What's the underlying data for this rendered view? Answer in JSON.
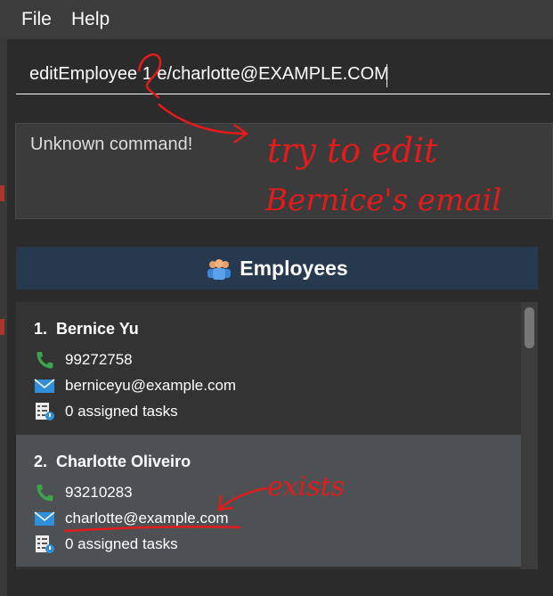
{
  "menu": {
    "file": "File",
    "help": "Help"
  },
  "command": {
    "value": "editEmployee 1 e/charlotte@EXAMPLE.COM"
  },
  "result": {
    "message": "Unknown command!"
  },
  "employees": {
    "title": "Employees",
    "items": [
      {
        "index": "1.",
        "name": "Bernice Yu",
        "phone": "99272758",
        "email": "berniceyu@example.com",
        "tasks": "0 assigned tasks"
      },
      {
        "index": "2.",
        "name": "Charlotte Oliveiro",
        "phone": "93210283",
        "email": "charlotte@example.com",
        "tasks": "0 assigned tasks"
      }
    ]
  },
  "annotations": {
    "note1": "try to edit",
    "note2": "Bernice's email",
    "note3": "exists",
    "color": "#e31b1b"
  },
  "colors": {
    "header_bg": "#26394f",
    "selected_card": "#4e5153",
    "phone_icon": "#3fa34d",
    "mail_icon": "#2f8fd8"
  }
}
